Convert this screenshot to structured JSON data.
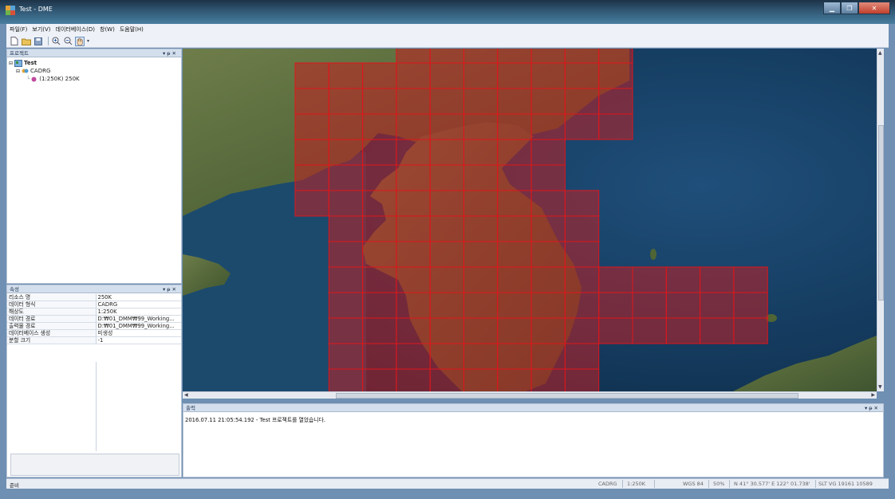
{
  "window": {
    "title": "Test - DME"
  },
  "menu": [
    "파일(F)",
    "보기(V)",
    "데이터베이스(D)",
    "창(W)",
    "도움말(H)"
  ],
  "toolbar": {
    "icons": [
      "new-file-icon",
      "open-folder-icon",
      "save-icon",
      "zoom-in-icon",
      "zoom-out-icon",
      "pan-hand-icon"
    ]
  },
  "project_panel": {
    "title": "프로젝트",
    "tree": {
      "root": "Test",
      "child": "CADRG",
      "leaf": "(1:250K) 250K"
    }
  },
  "properties_panel": {
    "title": "속성",
    "rows": [
      {
        "key": "리소스 명",
        "value": "250K"
      },
      {
        "key": "데이터 형식",
        "value": "CADRG"
      },
      {
        "key": "해상도",
        "value": "1:250K"
      },
      {
        "key": "데이터 경로",
        "value": "D:₩01_DMM₩99_Working..."
      },
      {
        "key": "출력물 경로",
        "value": "D:₩01_DMM₩99_Working..."
      },
      {
        "key": "데이터베이스 생성",
        "value": "미생성"
      },
      {
        "key": "분할 크기",
        "value": "-1"
      }
    ]
  },
  "output_panel": {
    "title": "출력",
    "line": "2016.07.11 21:05:54.192 - Test 프로젝트를 열었습니다."
  },
  "status": {
    "ready": "준비",
    "format": "CADRG",
    "scale": "1:250K",
    "datum": "WGS 84",
    "zoom": "50%",
    "coords": "N 41° 30.577' E 122° 01.738'",
    "tile": "SLT VG 19161 10589"
  },
  "colors": {
    "tile_fill": "#c21f22",
    "tile_stroke": "#e0151a",
    "sea": "#133a5a",
    "land": "#556b3a"
  }
}
